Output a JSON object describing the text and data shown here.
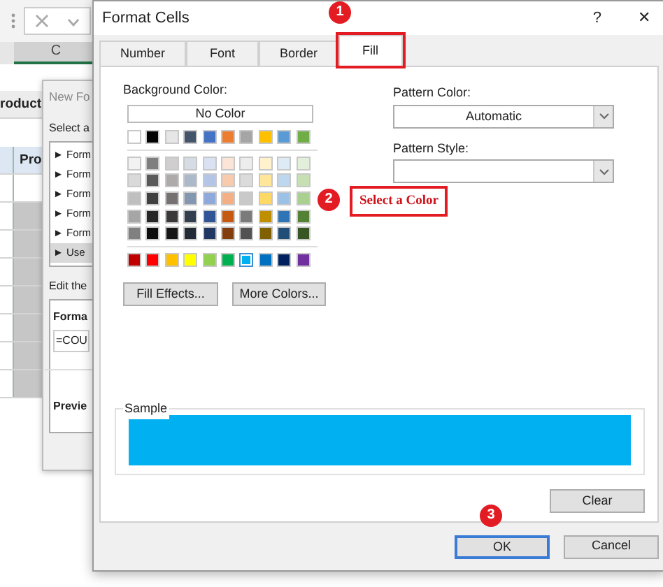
{
  "excel": {
    "column_header": "C",
    "cells": [
      {
        "text": "roduct"
      },
      {
        "text": "Pro"
      }
    ]
  },
  "new_formatting_dialog": {
    "title": "New Fo",
    "select_label": "Select a",
    "rule_types": [
      {
        "label": "► Form",
        "selected": false
      },
      {
        "label": "► Form",
        "selected": false
      },
      {
        "label": "► Form",
        "selected": false
      },
      {
        "label": "► Form",
        "selected": false
      },
      {
        "label": "► Form",
        "selected": false
      },
      {
        "label": "► Use",
        "selected": true
      }
    ],
    "edit_label": "Edit the",
    "format_label": "Forma",
    "formula": "=COU",
    "preview_label": "Previe"
  },
  "format_cells": {
    "title": "Format Cells",
    "help": "?",
    "close": "✕",
    "tabs": [
      {
        "label": "Number",
        "selected": false,
        "highlighted": false
      },
      {
        "label": "Font",
        "selected": false,
        "highlighted": false
      },
      {
        "label": "Border",
        "selected": false,
        "highlighted": false
      },
      {
        "label": "Fill",
        "selected": true,
        "highlighted": true
      }
    ],
    "background_color_label": "Background Color:",
    "no_color_button": "No Color",
    "theme_colors": [
      {
        "color": "#ffffff",
        "selected": false
      },
      {
        "color": "#000000",
        "selected": false
      },
      {
        "color": "#e7e6e6",
        "selected": false
      },
      {
        "color": "#44546a",
        "selected": false
      },
      {
        "color": "#4472c4",
        "selected": false
      },
      {
        "color": "#ed7d31",
        "selected": false
      },
      {
        "color": "#a5a5a5",
        "selected": false
      },
      {
        "color": "#ffc000",
        "selected": false
      },
      {
        "color": "#5b9bd5",
        "selected": false
      },
      {
        "color": "#70ad47",
        "selected": false
      }
    ],
    "tint_rows": [
      [
        {
          "color": "#f2f2f2",
          "selected": false
        },
        {
          "color": "#7f7f7f",
          "selected": false
        },
        {
          "color": "#d0cece",
          "selected": false
        },
        {
          "color": "#d6dce4",
          "selected": false
        },
        {
          "color": "#d9e1f2",
          "selected": false
        },
        {
          "color": "#fce4d6",
          "selected": false
        },
        {
          "color": "#ededed",
          "selected": false
        },
        {
          "color": "#fff2cc",
          "selected": false
        },
        {
          "color": "#ddebf7",
          "selected": false
        },
        {
          "color": "#e2efda",
          "selected": false
        }
      ],
      [
        {
          "color": "#d9d9d9",
          "selected": false
        },
        {
          "color": "#595959",
          "selected": false
        },
        {
          "color": "#aeaaaa",
          "selected": false
        },
        {
          "color": "#acb9ca",
          "selected": false
        },
        {
          "color": "#b4c6e7",
          "selected": false
        },
        {
          "color": "#f8cbad",
          "selected": false
        },
        {
          "color": "#dbdbdb",
          "selected": false
        },
        {
          "color": "#ffe699",
          "selected": false
        },
        {
          "color": "#bdd7ee",
          "selected": false
        },
        {
          "color": "#c6e0b4",
          "selected": false
        }
      ],
      [
        {
          "color": "#bfbfbf",
          "selected": false
        },
        {
          "color": "#404040",
          "selected": false
        },
        {
          "color": "#757171",
          "selected": false
        },
        {
          "color": "#8497b0",
          "selected": false
        },
        {
          "color": "#8ea9db",
          "selected": false
        },
        {
          "color": "#f4b084",
          "selected": false
        },
        {
          "color": "#c9c9c9",
          "selected": false
        },
        {
          "color": "#ffd966",
          "selected": false
        },
        {
          "color": "#9bc2e6",
          "selected": false
        },
        {
          "color": "#a9d08e",
          "selected": false
        }
      ],
      [
        {
          "color": "#a6a6a6",
          "selected": false
        },
        {
          "color": "#262626",
          "selected": false
        },
        {
          "color": "#3a3838",
          "selected": false
        },
        {
          "color": "#333f4f",
          "selected": false
        },
        {
          "color": "#305496",
          "selected": false
        },
        {
          "color": "#c65911",
          "selected": false
        },
        {
          "color": "#7b7b7b",
          "selected": false
        },
        {
          "color": "#bf8f00",
          "selected": false
        },
        {
          "color": "#2f75b5",
          "selected": false
        },
        {
          "color": "#548235",
          "selected": false
        }
      ],
      [
        {
          "color": "#808080",
          "selected": false
        },
        {
          "color": "#0d0d0d",
          "selected": false
        },
        {
          "color": "#161616",
          "selected": false
        },
        {
          "color": "#222b35",
          "selected": false
        },
        {
          "color": "#203764",
          "selected": false
        },
        {
          "color": "#833c0c",
          "selected": false
        },
        {
          "color": "#525252",
          "selected": false
        },
        {
          "color": "#806000",
          "selected": false
        },
        {
          "color": "#1f4e78",
          "selected": false
        },
        {
          "color": "#375623",
          "selected": false
        }
      ]
    ],
    "standard_colors": [
      {
        "color": "#c00000",
        "selected": false
      },
      {
        "color": "#ff0000",
        "selected": false
      },
      {
        "color": "#ffc000",
        "selected": false
      },
      {
        "color": "#ffff00",
        "selected": false
      },
      {
        "color": "#92d050",
        "selected": false
      },
      {
        "color": "#00b050",
        "selected": false
      },
      {
        "color": "#00b0f0",
        "selected": true
      },
      {
        "color": "#0070c0",
        "selected": false
      },
      {
        "color": "#002060",
        "selected": false
      },
      {
        "color": "#7030a0",
        "selected": false
      }
    ],
    "fill_effects_button": "Fill Effects...",
    "more_colors_button": "More Colors...",
    "pattern_color": {
      "label": "Pattern Color:",
      "value": "Automatic"
    },
    "pattern_style": {
      "label": "Pattern Style:"
    },
    "sample_label": "Sample",
    "clear_button": "Clear",
    "footer_buttons": [
      {
        "label": "OK",
        "default": true
      },
      {
        "label": "Cancel",
        "default": false
      }
    ]
  },
  "annotations": [
    {
      "number": "1"
    },
    {
      "number": "2",
      "callout": "Select a Color"
    },
    {
      "number": "3"
    }
  ]
}
